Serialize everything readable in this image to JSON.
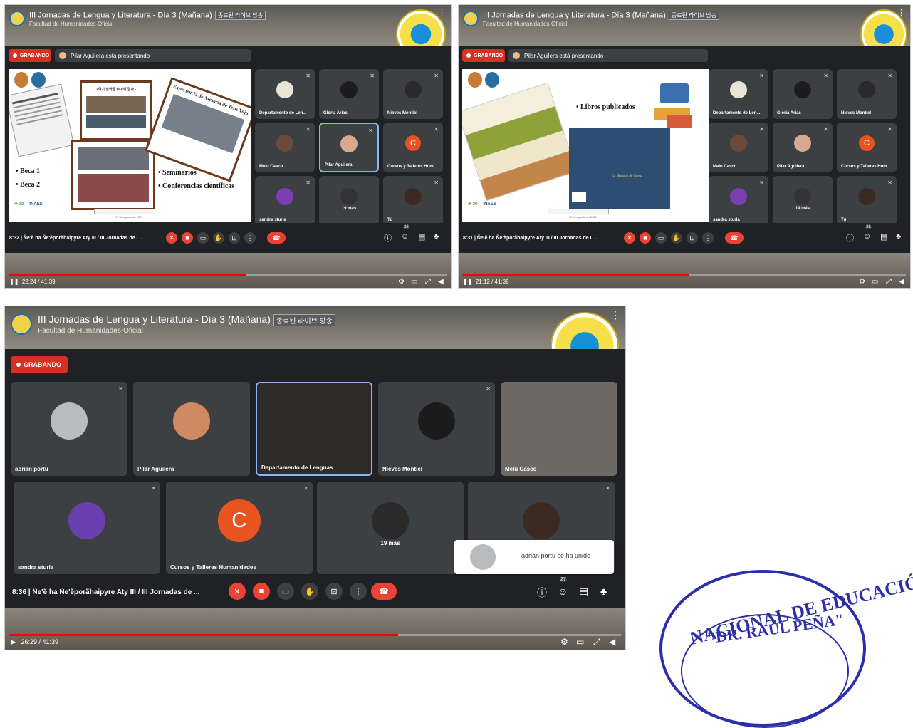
{
  "stream_title": "III Jornadas de Lengua y Literatura - Día 3 (Mañana)",
  "stream_tag": "종료된 라이브 방송",
  "channel": "Facultad de Humanidades-Oficial",
  "recording_label": "GRABANDO",
  "presenting_text": "Pilar Aguilera está presentando",
  "meeting_name": "Ñe'ẽ ha Ñe'ẽporãhaipyre Aty III / III Jornadas de ...",
  "meeting_name_short": "Ñe'ẽ ha Ñe'ẽporãhaipyre Aty III / III Jornadas de L...",
  "frame1": {
    "meet_time": "8:32",
    "video_time": "22:24 / 41:39",
    "progress": 0.54,
    "people_count": "28",
    "slide": {
      "items": [
        "• Beca 1",
        "• Beca 2"
      ],
      "right_items": [
        "• Seminarios",
        "• Conferencias científicas"
      ],
      "photo_caption": "Experiencia de Asesoría de Tesis Yoju",
      "korean_title": "2학기 장학금 수여식 결과 -",
      "footer_org": "INAES",
      "footer_date": "17 de agosto de 2021"
    },
    "tiles": [
      {
        "name": "Departamento de Len..."
      },
      {
        "name": "Gloria Arias"
      },
      {
        "name": "Nieves Montiel"
      },
      {
        "name": "Melu Casco"
      },
      {
        "name": "Pilar Aguilera"
      },
      {
        "name": "Cursos y Talleres Hum..."
      },
      {
        "name": "sandra sturla"
      },
      {
        "name": "19 más"
      },
      {
        "name": "Tú"
      }
    ]
  },
  "frame2": {
    "meet_time": "8:31",
    "video_time": "21:12 / 41:39",
    "progress": 0.51,
    "people_count": "28",
    "slide": {
      "heading": "• Libros publicados",
      "book_title": "La Historia de Corea",
      "footer_org": "INAES",
      "footer_date": "18 de agosto de 2021"
    },
    "tiles": [
      {
        "name": "Departamento de Len..."
      },
      {
        "name": "Gloria Arias"
      },
      {
        "name": "Nieves Montiel"
      },
      {
        "name": "Melu Casco"
      },
      {
        "name": "Pilar Aguilera"
      },
      {
        "name": "Cursos y Talleres Hum..."
      },
      {
        "name": "sandra sturla"
      },
      {
        "name": "19 más"
      },
      {
        "name": "Tú"
      }
    ]
  },
  "frame3": {
    "meet_time": "8:36",
    "video_time": "26:29 / 41:39",
    "progress": 0.636,
    "people_count": "27",
    "tiles_row1": [
      {
        "name": "adrian portu"
      },
      {
        "name": "Pilar Aguilera"
      },
      {
        "name": "Departamento de Lenguas"
      },
      {
        "name": "Nieves Montiel"
      },
      {
        "name": "Melu Casco"
      }
    ],
    "tiles_row2": [
      {
        "name": "sandra sturla"
      },
      {
        "name": "Cursos y Talleres Humanidades"
      },
      {
        "name": "19 más"
      },
      {
        "name": ""
      }
    ],
    "c_letter": "C",
    "toast_text": "adrian portu se ha unido"
  },
  "stamp": {
    "line1": "NACIONAL DE EDUCACIÓN",
    "line2": "\"DR. RAÚL PEÑA\""
  },
  "colors": {
    "meet_bg": "#202124",
    "tile_bg": "#3c4043",
    "record_red": "#d93025",
    "end_call_red": "#ea4335",
    "active_blue": "#8ab4f8",
    "stamp_blue": "#2d2fa8",
    "c_avatar": "#e8531f"
  },
  "icons": [
    "mic-off-icon",
    "camera-off-icon",
    "captions-icon",
    "raise-hand-icon",
    "present-icon",
    "more-options-icon",
    "end-call-icon",
    "info-icon",
    "people-icon",
    "chat-icon",
    "activities-icon",
    "play-icon",
    "pause-icon",
    "settings-icon",
    "miniplayer-icon",
    "fullscreen-icon",
    "volume-icon"
  ]
}
